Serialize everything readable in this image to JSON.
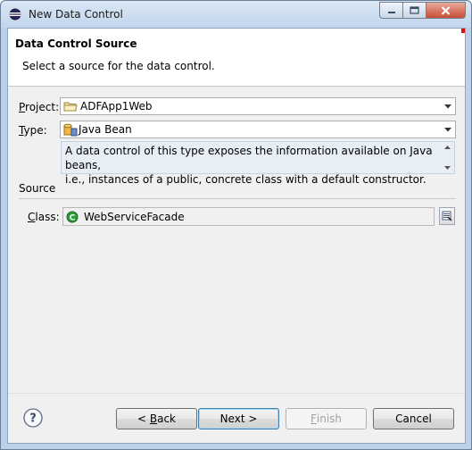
{
  "window": {
    "title": "New Data Control",
    "icon": "eclipse-icon"
  },
  "header": {
    "title": "Data Control Source",
    "subtitle": "Select a source for the data control."
  },
  "form": {
    "project": {
      "label_mnemonic": "P",
      "label_rest": "roject:",
      "value": "ADFApp1Web",
      "icon": "folder-icon"
    },
    "type": {
      "label_mnemonic": "T",
      "label_rest": "ype:",
      "value": "Java Bean",
      "icon": "java-bean-icon",
      "description_line1": "A data control of this type exposes the information available on Java beans,",
      "description_line2": "i.e., instances of a public, concrete class with a default constructor."
    },
    "source_section": "Source",
    "class": {
      "label_mnemonic": "C",
      "label_rest": "lass:",
      "value": "WebServiceFacade",
      "icon": "class-icon"
    }
  },
  "buttons": {
    "back_prefix": "< ",
    "back_mnemonic": "B",
    "back_rest": "ack",
    "next": "Next >",
    "finish_mnemonic": "F",
    "finish_rest": "inish",
    "cancel": "Cancel"
  },
  "colors": {
    "title_bg": "#c3d6ec",
    "close_btn": "#c74f36",
    "class_icon": "#2e9a3c"
  }
}
